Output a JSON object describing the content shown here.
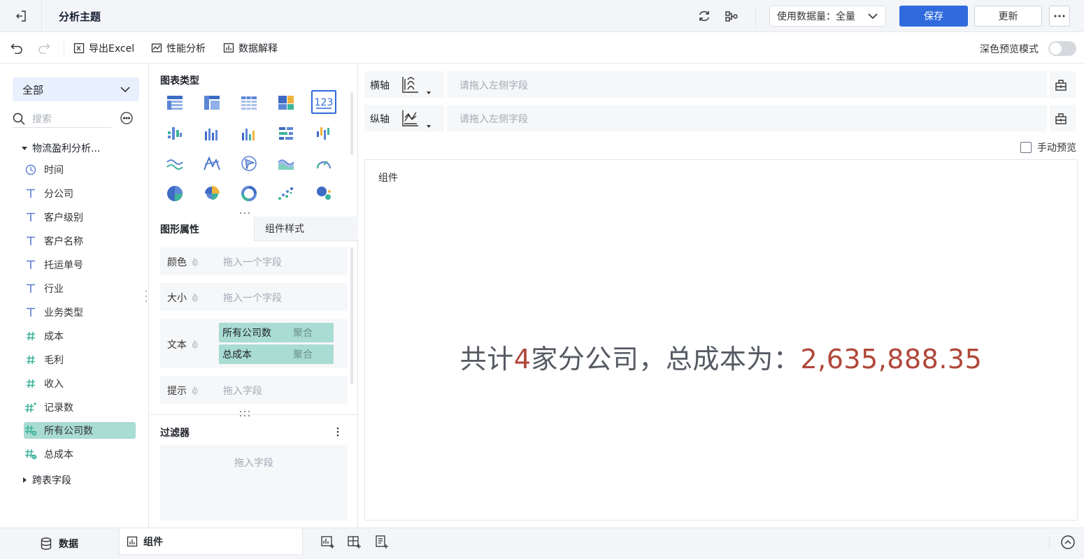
{
  "header": {
    "title": "分析主题",
    "data_usage": "使用数据量：全量",
    "save_label": "保存",
    "update_label": "更新"
  },
  "toolbar": {
    "export_label": "导出Excel",
    "perf_label": "性能分析",
    "explain_label": "数据解释",
    "dark_mode_label": "深色预览模式",
    "dark_mode_on": false
  },
  "data_panel": {
    "scope": "全部",
    "search_placeholder": "搜索",
    "dataset_name": "物流盈利分析...",
    "fields": [
      {
        "type": "date",
        "name": "时间"
      },
      {
        "type": "text",
        "name": "分公司"
      },
      {
        "type": "text",
        "name": "客户级别"
      },
      {
        "type": "text",
        "name": "客户名称"
      },
      {
        "type": "text",
        "name": "托运单号"
      },
      {
        "type": "text",
        "name": "行业"
      },
      {
        "type": "text",
        "name": "业务类型"
      },
      {
        "type": "number",
        "name": "成本"
      },
      {
        "type": "number",
        "name": "毛利"
      },
      {
        "type": "number",
        "name": "收入"
      },
      {
        "type": "count",
        "name": "记录数"
      },
      {
        "type": "calc",
        "name": "所有公司数",
        "selected": true
      },
      {
        "type": "calc",
        "name": "总成本"
      }
    ],
    "cross_table": "跨表字段"
  },
  "config_panel": {
    "chart_type_title": "图表类型",
    "tab_props": "图形属性",
    "tab_style": "组件样式",
    "props": {
      "color_label": "颜色",
      "color_placeholder": "拖入一个字段",
      "size_label": "大小",
      "size_placeholder": "拖入一个字段",
      "text_label": "文本",
      "text_pills": [
        {
          "name": "所有公司数",
          "agg": "聚合"
        },
        {
          "name": "总成本",
          "agg": "聚合"
        }
      ],
      "tip_label": "提示",
      "tip_placeholder": "拖入字段"
    },
    "filter_title": "过滤器",
    "filter_placeholder": "拖入字段"
  },
  "axes": {
    "x_label": "横轴",
    "x_placeholder": "请拖入左侧字段",
    "y_label": "纵轴",
    "y_placeholder": "请拖入左侧字段",
    "manual_preview": "手动预览"
  },
  "canvas": {
    "title": "组件",
    "text_prefix": "共计",
    "company_count": "4",
    "text_middle": "家分公司，总成本为：",
    "total_cost": "2,635,888.35"
  },
  "bottom": {
    "data_tab": "数据",
    "component_tab": "组件"
  },
  "colors": {
    "primary": "#2f6bdc",
    "pill": "#a9dcd3",
    "highlight": "#b0473a",
    "field_icon_text": "#5b7bd5",
    "field_icon_number": "#3fb39c"
  }
}
